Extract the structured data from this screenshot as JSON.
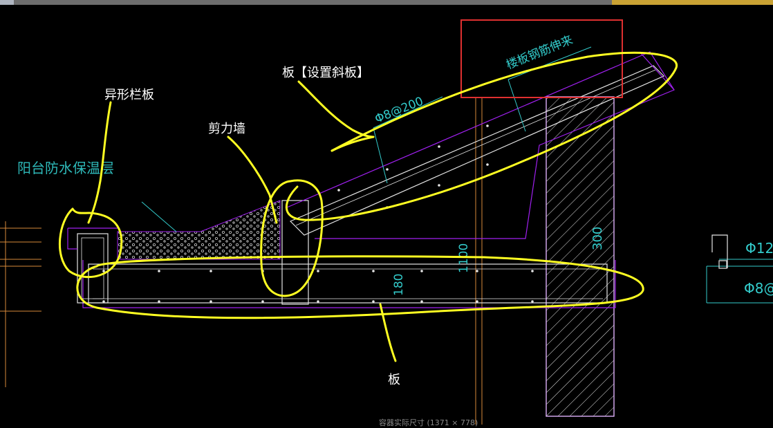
{
  "labels": {
    "railing": "异形栏板",
    "shear_wall": "剪力墙",
    "slab_sloped": "板【设置斜板】",
    "slab": "板"
  },
  "drawing_text": {
    "rebar_extend": "楼板钢筋伸来",
    "rebar_spec": "Φ8@200",
    "note_load": "阳台防水保温层",
    "dim_1100": "1100",
    "dim_180": "180",
    "dim_300": "300",
    "legend_phi12": "Φ12",
    "legend_phi8": "Φ8@"
  },
  "status_text": "容器实际尺寸 (1371 × 778)",
  "colors": {
    "highlight": "#ffff22",
    "callout_box": "#e03030",
    "cad_cyan": "#33cccc",
    "cad_purple": "#a020f0",
    "cad_white": "#e6e6e6"
  }
}
